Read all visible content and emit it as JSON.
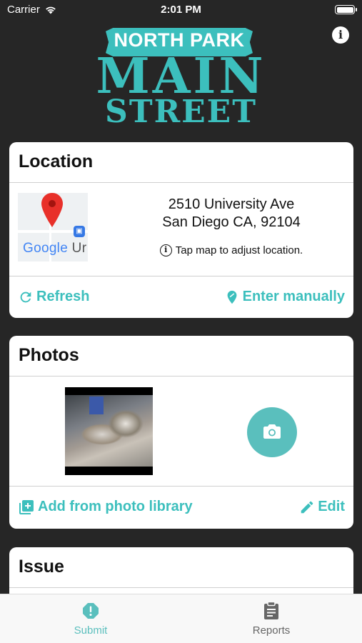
{
  "status_bar": {
    "carrier": "Carrier",
    "time": "2:01 PM"
  },
  "logo": {
    "line1": "NORTH PARK",
    "line2": "MAIN",
    "line3": "STREET"
  },
  "header": {
    "info_icon": "info-icon"
  },
  "location": {
    "title": "Location",
    "map_attribution": "Google",
    "map_attribution_suffix": "Ur",
    "address_line1": "2510 University Ave",
    "address_line2": "San Diego CA, 92104",
    "hint": "Tap map to adjust location.",
    "refresh_label": "Refresh",
    "manual_label": "Enter manually"
  },
  "photos": {
    "title": "Photos",
    "add_library_label": "Add from photo library",
    "edit_label": "Edit"
  },
  "issue": {
    "title": "Issue"
  },
  "tabs": [
    {
      "label": "Submit",
      "icon": "alert-icon",
      "active": true
    },
    {
      "label": "Reports",
      "icon": "clipboard-icon",
      "active": false
    }
  ],
  "colors": {
    "accent": "#3cbfbd",
    "background": "#262626",
    "card": "#ffffff"
  }
}
